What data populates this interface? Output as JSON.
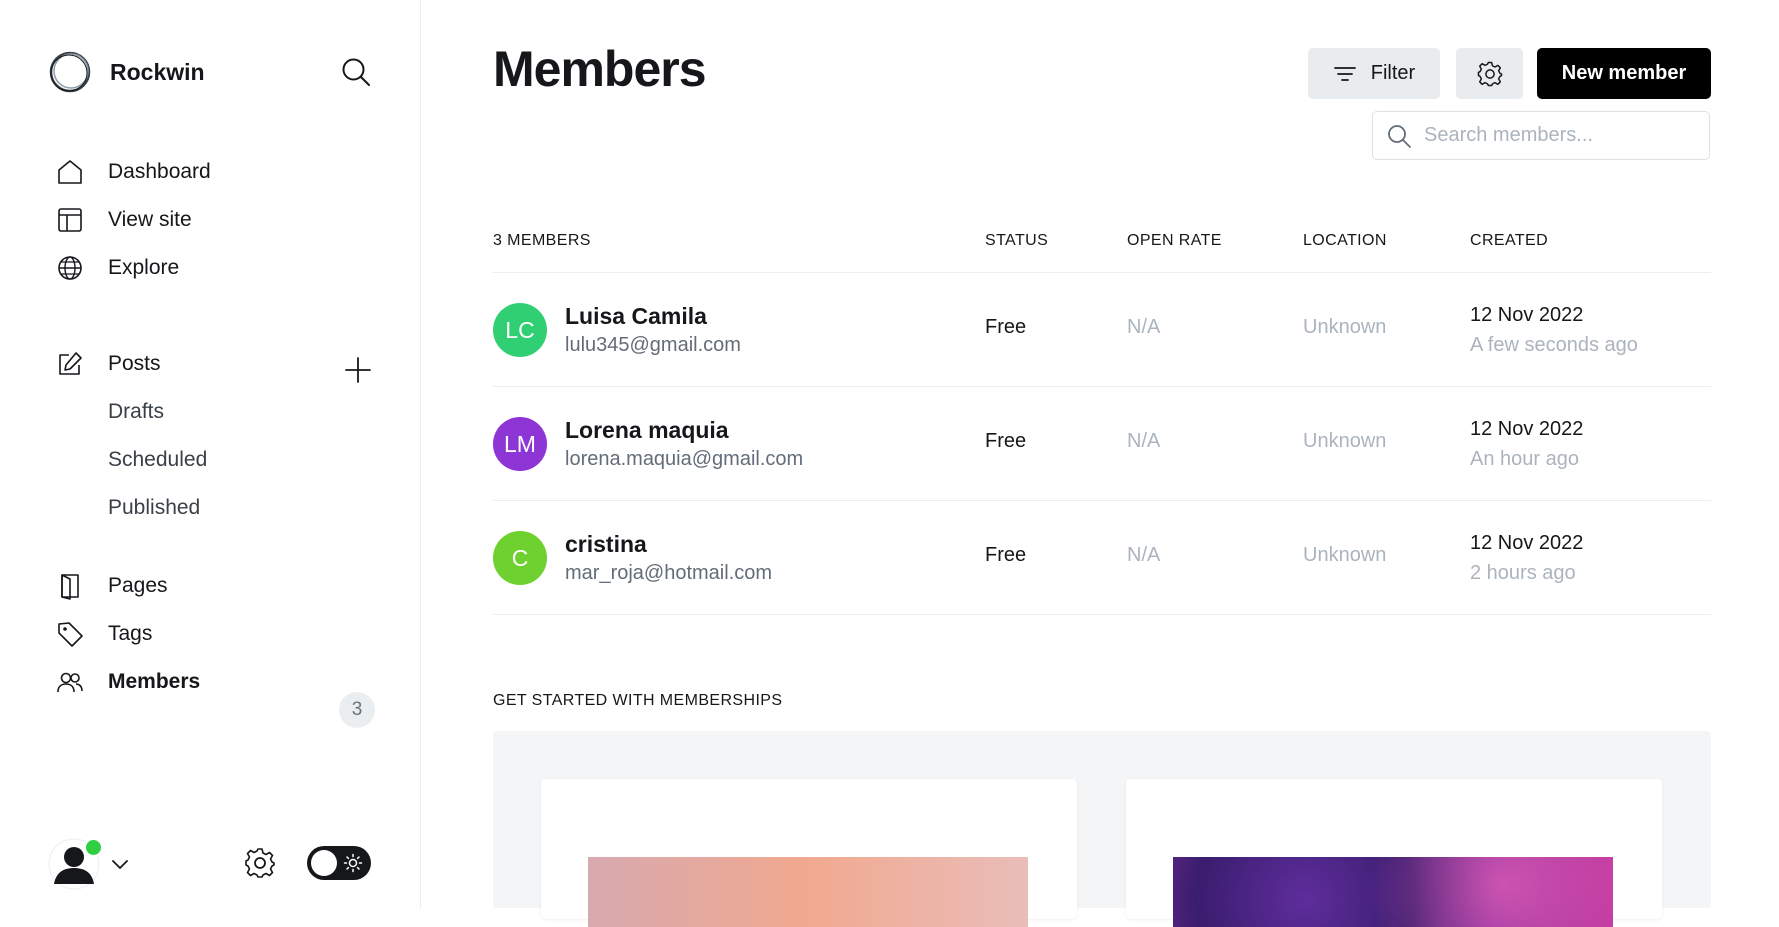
{
  "app": {
    "name": "Rockwin"
  },
  "sidebar": {
    "nav": [
      {
        "label": "Dashboard",
        "icon": "home-icon"
      },
      {
        "label": "View site",
        "icon": "layout-icon"
      },
      {
        "label": "Explore",
        "icon": "globe-icon"
      }
    ],
    "posts": {
      "label": "Posts",
      "icon": "edit-icon"
    },
    "posts_sub": [
      "Drafts",
      "Scheduled",
      "Published"
    ],
    "bottom_nav": [
      {
        "label": "Pages",
        "icon": "book-icon"
      },
      {
        "label": "Tags",
        "icon": "tag-icon"
      },
      {
        "label": "Members",
        "icon": "users-icon",
        "active": true,
        "count": "3"
      }
    ],
    "user": {
      "online": true,
      "status_color": "#30cf43"
    },
    "theme": {
      "mode": "light"
    }
  },
  "header": {
    "title": "Members",
    "filter_label": "Filter",
    "new_member_label": "New member",
    "search_placeholder": "Search members..."
  },
  "table": {
    "columns": {
      "members": "3 MEMBERS",
      "status": "STATUS",
      "open_rate": "OPEN RATE",
      "location": "LOCATION",
      "created": "CREATED"
    },
    "rows": [
      {
        "initials": "LC",
        "color": "#30cf73",
        "name": "Luisa Camila",
        "email": "lulu345@gmail.com",
        "status": "Free",
        "open_rate": "N/A",
        "location": "Unknown",
        "created_date": "12 Nov 2022",
        "created_ago": "A few seconds ago"
      },
      {
        "initials": "LM",
        "color": "#8e35d6",
        "name": "Lorena maquia",
        "email": "lorena.maquia@gmail.com",
        "status": "Free",
        "open_rate": "N/A",
        "location": "Unknown",
        "created_date": "12 Nov 2022",
        "created_ago": "An hour ago"
      },
      {
        "initials": "C",
        "color": "#6fd12f",
        "name": "cristina",
        "email": "mar_roja@hotmail.com",
        "status": "Free",
        "open_rate": "N/A",
        "location": "Unknown",
        "created_date": "12 Nov 2022",
        "created_ago": "2 hours ago"
      }
    ]
  },
  "get_started": {
    "title": "GET STARTED WITH MEMBERSHIPS"
  }
}
